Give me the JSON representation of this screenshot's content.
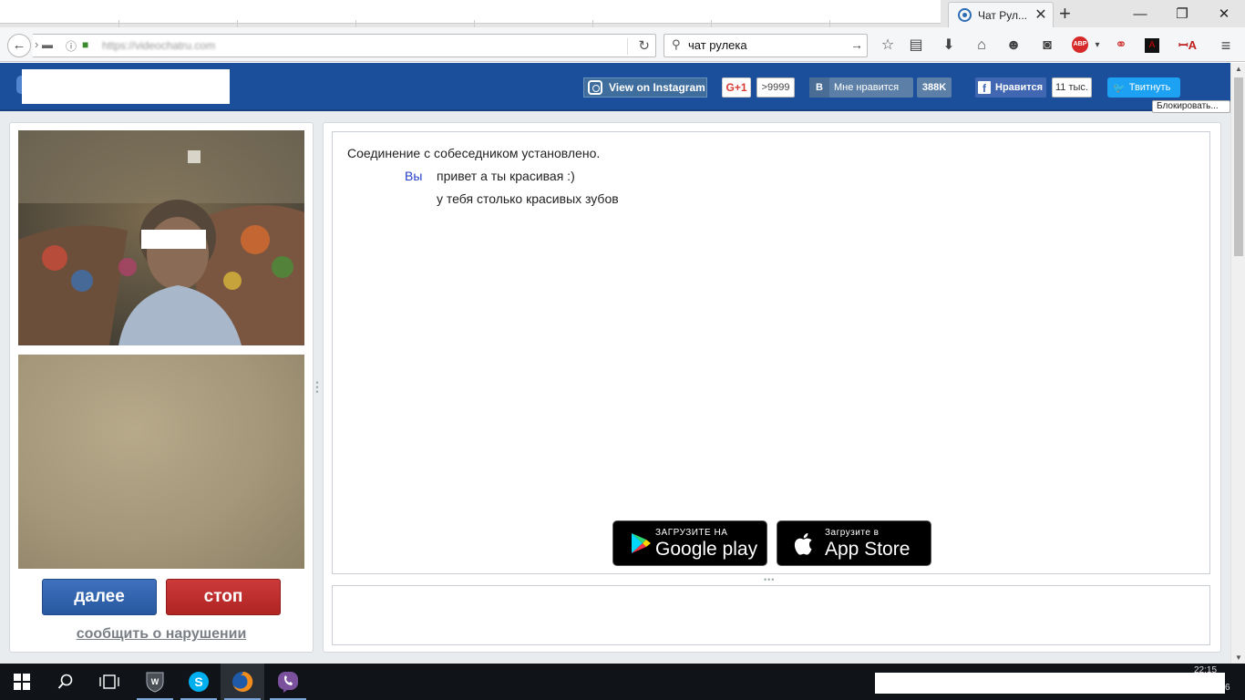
{
  "browser": {
    "tab_title": "Чат Рул...",
    "tab_close": "✕",
    "new_tab": "+",
    "window_controls": [
      "—",
      "❐",
      "✕"
    ],
    "url_text": "https://videochatru.com",
    "search_value": "чат рулека",
    "abp_label": "ABP",
    "toolbar_icons": [
      "star-icon",
      "reading-list-icon",
      "download-icon",
      "home-icon",
      "smiley-icon",
      "pocket-icon",
      "adblock-icon",
      "extension-icon",
      "pdf-icon",
      "translate-icon",
      "menu-icon"
    ]
  },
  "header": {
    "instagram_label": "View on Instagram",
    "gplus_label": "G+1",
    "gplus_count": ">9999",
    "vk_logo": "B",
    "vk_label": "Мне нравится",
    "vk_count": "388K",
    "fb_logo": "f",
    "fb_label": "Нравится",
    "fb_count": "11 тыс.",
    "tw_label": "Твитнуть",
    "block_tooltip": "Блокировать..."
  },
  "controls": {
    "next_label": "далее",
    "stop_label": "стоп",
    "report_label": "сообщить о нарушении"
  },
  "chat": {
    "status": "Соединение с собеседником установлено.",
    "messages": [
      {
        "author": "Вы",
        "text": "привет а ты красивая :)"
      },
      {
        "author": "",
        "text": "у тебя столько красивых зубов"
      }
    ],
    "input_placeholder": ""
  },
  "stores": {
    "google_small": "ЗАГРУЗИТЕ НА",
    "google_big": "Google play",
    "apple_small": "Загрузите в",
    "apple_big": "App Store"
  },
  "taskbar": {
    "time": "22:15",
    "date_fragment": "6",
    "apps": [
      "windows-start-icon",
      "search-icon",
      "task-view-icon",
      "world-of-tanks-icon",
      "skype-icon",
      "firefox-icon",
      "viber-icon"
    ]
  },
  "colors": {
    "header_blue": "#1b4f9c",
    "next_button": "#2f62ad",
    "stop_button": "#c03030",
    "author_blue": "#2540c8"
  }
}
